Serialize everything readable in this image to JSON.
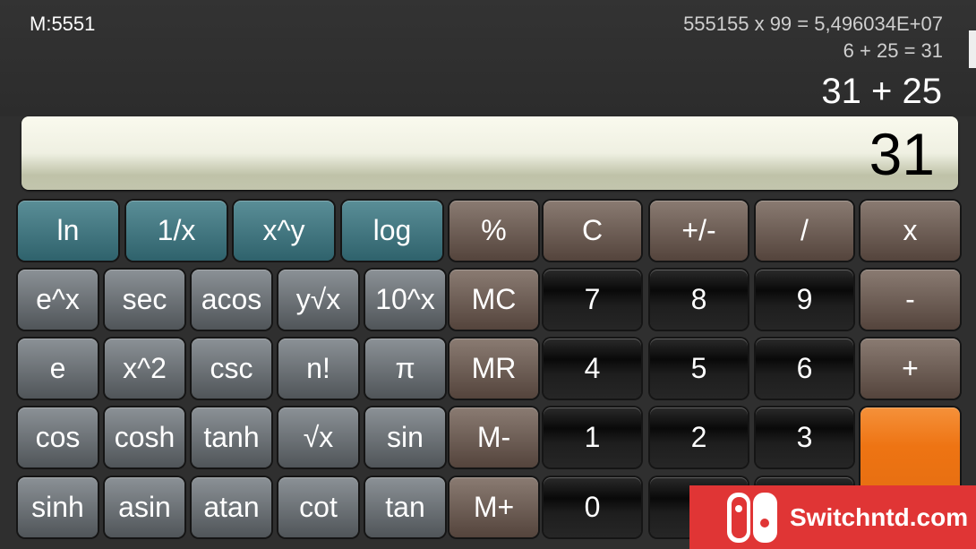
{
  "memory": "M:5551",
  "history": [
    "555155 x 99 = 5,496034E+07",
    "6 + 25 = 31"
  ],
  "expression": "31 + 25",
  "display": "31",
  "colors": {
    "scientific_top": "#3f7680",
    "scientific": "#6b7075",
    "operator": "#6d5d54",
    "number": "#111111",
    "equals": "#ee7413"
  },
  "scientific_row1": [
    "ln",
    "1/x",
    "x^y",
    "log"
  ],
  "scientific_grid": [
    [
      "e^x",
      "sec",
      "acos",
      "y√x",
      "10^x"
    ],
    [
      "e",
      "x^2",
      "csc",
      "n!",
      "π"
    ],
    [
      "cos",
      "cosh",
      "tanh",
      "√x",
      "sin"
    ],
    [
      "sinh",
      "asin",
      "atan",
      "cot",
      "tan"
    ]
  ],
  "operators_row1": [
    "%",
    "C",
    "+/-",
    "/",
    "x"
  ],
  "memory_keys": [
    "MC",
    "MR",
    "M-",
    "M+"
  ],
  "number_grid": [
    [
      "7",
      "8",
      "9"
    ],
    [
      "4",
      "5",
      "6"
    ],
    [
      "1",
      "2",
      "3"
    ],
    [
      "0",
      "",
      ""
    ]
  ],
  "right_column": [
    "-",
    "+",
    "="
  ],
  "watermark": "Switchntd.com"
}
